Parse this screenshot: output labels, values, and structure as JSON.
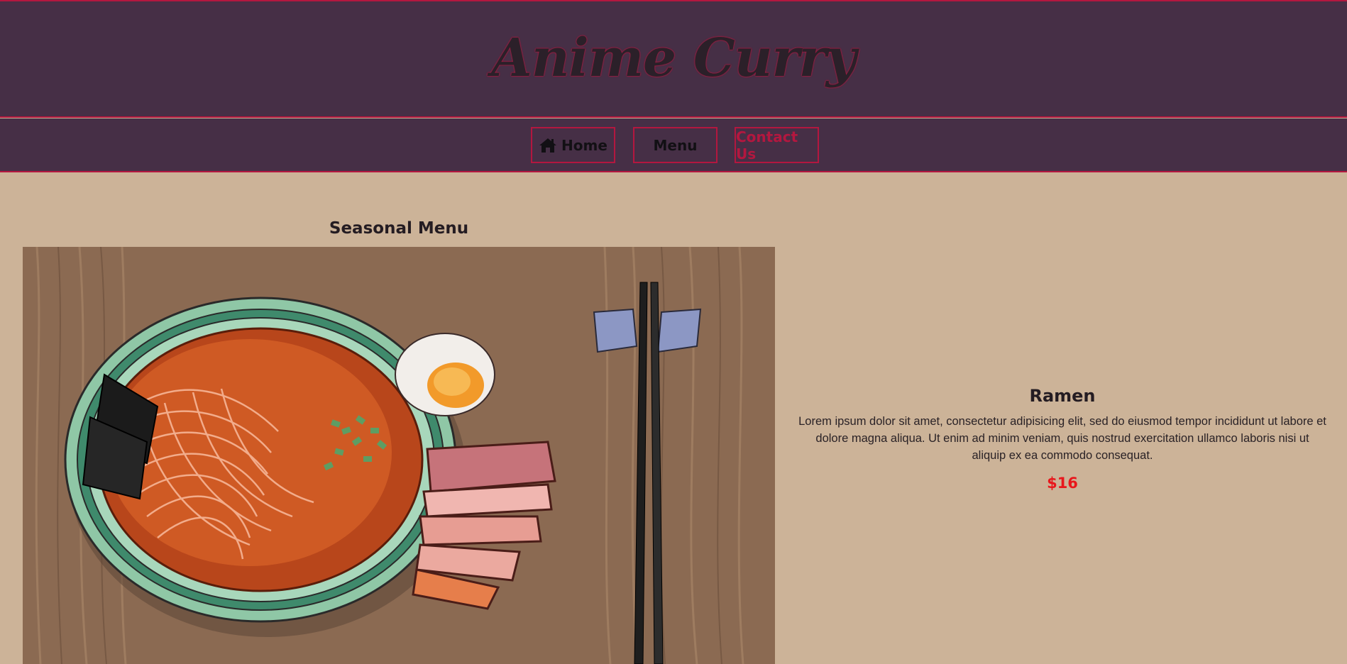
{
  "header": {
    "title": "Anime Curry"
  },
  "nav": {
    "items": [
      {
        "label": "Home",
        "icon": "home-icon"
      },
      {
        "label": "Menu"
      },
      {
        "label": "Contact Us"
      }
    ]
  },
  "main": {
    "section_title": "Seasonal Menu",
    "dish": {
      "name": "Ramen",
      "description": "Lorem ipsum dolor sit amet, consectetur adipisicing elit, sed do eiusmod tempor incididunt ut labore et dolore magna aliqua. Ut enim ad minim veniam, quis nostrud exercitation ullamco laboris nisi ut aliquip ex ea commodo consequat.",
      "price": "$16"
    }
  },
  "colors": {
    "header_bg": "#462f46",
    "accent": "#b3173f",
    "page_bg": "#ccb398",
    "price": "#e8171c"
  }
}
